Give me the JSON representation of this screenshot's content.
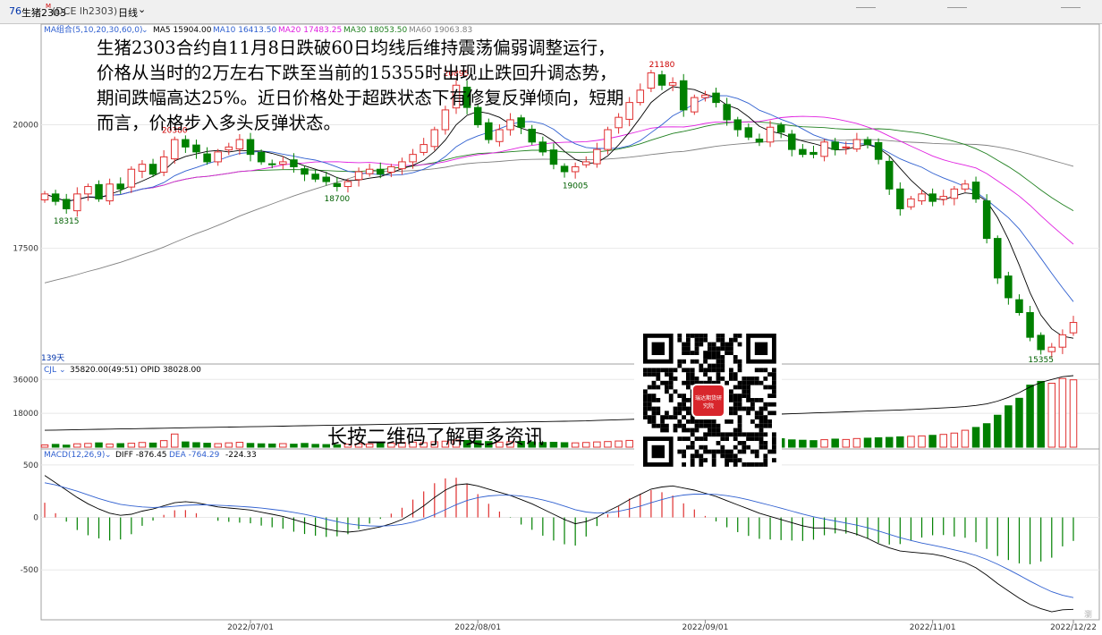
{
  "window": {
    "code_badge": "76",
    "instrument": "生猪2303",
    "superscript": "M",
    "exchange_code": "(DCE lh2303)",
    "period": "日线"
  },
  "indicators": {
    "ma_legend": "MA组合(5,10,20,30,60,0)",
    "ma5": "MA5 15904.00",
    "ma10": "MA10 16413.50",
    "ma20": "MA20 17483.25",
    "ma30": "MA30 18053.50",
    "ma60": "MA60 19063.83",
    "vol_legend": "CJL",
    "vol_text": "35820.00(49:51)",
    "opid_text": "OPID 38028.00",
    "macd_legend": "MACD(12,26,9)",
    "diff_text": "DIFF -876.45",
    "dea_text": "DEA -764.29",
    "macd_val": "-224.33",
    "bars_count": "139天"
  },
  "annotations": {
    "commentary": "生猪2303合约自11月8日跌破60日均线后维持震荡偏弱调整运行，价格从当时的2万左右下跌至当前的15355时出现止跌回升调态势，期间跌幅高达25%。近日价格处于超跌状态下有修复反弹倾向，短期而言，价格步入多头反弹状态。",
    "qr_caption": "长按二维码了解更多资讯",
    "qr_logo_text": "瑞达期货研究院",
    "watermark": "瀏"
  },
  "colors": {
    "up": "#e03030",
    "down": "#008000",
    "ma5": "#000000",
    "ma10": "#3060d0",
    "ma20": "#e020e0",
    "ma30": "#208020",
    "ma60": "#808080",
    "grid": "#e8e8e8"
  },
  "chart_data": {
    "type": "candlestick",
    "title": "生猪2303 (DCE lh2303) 日线",
    "x_dates": [
      "2022/07/01",
      "2022/08/01",
      "2022/09/01",
      "2022/11/01",
      "2022/12/22"
    ],
    "price_axis": {
      "ticks": [
        20000,
        17500
      ],
      "range": [
        15250,
        21800
      ]
    },
    "volume_axis": {
      "ticks": [
        36000,
        18000
      ],
      "range": [
        0,
        39000
      ]
    },
    "macd_axis": {
      "ticks": [
        500,
        0,
        -500
      ],
      "range": [
        -950,
        550
      ]
    },
    "labeled_prices": [
      {
        "label": "18315",
        "kind": "low"
      },
      {
        "label": "20380",
        "kind": "high"
      },
      {
        "label": "18700",
        "kind": "low"
      },
      {
        "label": "20895",
        "kind": "high"
      },
      {
        "label": "19005",
        "kind": "low"
      },
      {
        "label": "21180",
        "kind": "high"
      },
      {
        "label": "15355",
        "kind": "low"
      }
    ],
    "close_path": [
      18600,
      18450,
      18300,
      18600,
      18750,
      18500,
      18800,
      18700,
      19100,
      19200,
      19000,
      19350,
      19700,
      19550,
      19450,
      19250,
      19450,
      19550,
      19700,
      19400,
      19250,
      19200,
      19250,
      19150,
      19000,
      18900,
      18850,
      18750,
      18850,
      19050,
      19100,
      19000,
      19150,
      19250,
      19400,
      19600,
      19900,
      20300,
      20800,
      20350,
      20000,
      19700,
      19900,
      20100,
      19950,
      19650,
      19450,
      19200,
      19050,
      19150,
      19250,
      19500,
      19900,
      20150,
      20450,
      20700,
      21050,
      20800,
      20850,
      20300,
      20550,
      20600,
      20450,
      20100,
      19900,
      19750,
      19650,
      19950,
      19850,
      19500,
      19400,
      19400,
      19650,
      19500,
      19550,
      19700,
      19600,
      19300,
      18700,
      18300,
      18500,
      18600,
      18450,
      18550,
      18700,
      18800,
      18500,
      17700,
      16900,
      16500,
      16200,
      15700,
      15450,
      15500,
      15750,
      16000
    ],
    "volume": [
      1200,
      1500,
      1100,
      1800,
      2000,
      2300,
      1700,
      1900,
      2100,
      2500,
      2200,
      3500,
      7000,
      2800,
      2400,
      2100,
      1900,
      2300,
      2600,
      2000,
      1800,
      1700,
      1900,
      1600,
      2000,
      1500,
      1400,
      1300,
      1600,
      1800,
      1700,
      1900,
      2200,
      2500,
      2700,
      2400,
      2900,
      3200,
      3800,
      3600,
      3400,
      3000,
      2700,
      2900,
      3100,
      2800,
      2500,
      2600,
      2400,
      2300,
      2500,
      2800,
      3000,
      3300,
      3600,
      3400,
      3200,
      3500,
      3300,
      3100,
      3000,
      2900,
      3200,
      3400,
      3600,
      3800,
      4000,
      4200,
      4500,
      3900,
      3700,
      3500,
      4000,
      4300,
      4100,
      4600,
      4800,
      5000,
      5200,
      5500,
      5800,
      6000,
      6300,
      6800,
      7500,
      9000,
      10500,
      12500,
      17000,
      22000,
      26000,
      33000,
      35000,
      34000,
      36500,
      35820
    ],
    "opid": [
      9000,
      9100,
      9200,
      9300,
      9400,
      9500,
      9600,
      9700,
      9800,
      9900,
      10000,
      10100,
      10200,
      10300,
      10400,
      10500,
      10600,
      10700,
      10800,
      10900,
      11000,
      11100,
      11200,
      11300,
      11400,
      11500,
      11600,
      11700,
      11800,
      11900,
      12000,
      12100,
      12200,
      12300,
      12400,
      12500,
      12600,
      12700,
      12800,
      12900,
      13000,
      13100,
      13200,
      13300,
      13400,
      13500,
      13600,
      13700,
      13800,
      13900,
      14000,
      14200,
      14400,
      14600,
      14800,
      15000,
      15200,
      15400,
      15600,
      15800,
      16000,
      16200,
      16400,
      16600,
      16800,
      17000,
      17200,
      17400,
      17600,
      17800,
      18000,
      18200,
      18400,
      18600,
      18800,
      19000,
      19200,
      19400,
      19600,
      19800,
      20000,
      20300,
      20600,
      20900,
      21200,
      21600,
      22200,
      23000,
      24500,
      26500,
      29000,
      32000,
      34500,
      36000,
      37500,
      38028
    ],
    "diff": [
      400,
      330,
      260,
      190,
      130,
      80,
      40,
      20,
      30,
      60,
      80,
      110,
      140,
      150,
      140,
      120,
      100,
      90,
      80,
      70,
      50,
      30,
      10,
      -20,
      -50,
      -80,
      -110,
      -130,
      -140,
      -130,
      -110,
      -90,
      -60,
      -20,
      40,
      110,
      190,
      260,
      310,
      320,
      300,
      270,
      240,
      210,
      170,
      130,
      80,
      30,
      -20,
      -60,
      -40,
      0,
      60,
      110,
      170,
      220,
      270,
      290,
      300,
      280,
      260,
      230,
      200,
      160,
      120,
      80,
      40,
      10,
      -20,
      -50,
      -80,
      -100,
      -100,
      -110,
      -130,
      -160,
      -200,
      -250,
      -290,
      -320,
      -330,
      -340,
      -350,
      -370,
      -400,
      -430,
      -480,
      -550,
      -630,
      -700,
      -770,
      -830,
      -870,
      -900,
      -880,
      -876
    ],
    "dea": [
      330,
      310,
      280,
      250,
      215,
      180,
      150,
      125,
      110,
      100,
      95,
      98,
      106,
      115,
      120,
      120,
      116,
      111,
      105,
      98,
      89,
      77,
      64,
      48,
      29,
      7,
      -17,
      -40,
      -60,
      -74,
      -81,
      -83,
      -78,
      -66,
      -45,
      -14,
      27,
      74,
      121,
      161,
      189,
      205,
      212,
      212,
      204,
      189,
      167,
      140,
      108,
      74,
      51,
      41,
      45,
      58,
      80,
      108,
      140,
      170,
      196,
      213,
      222,
      223,
      219,
      207,
      190,
      168,
      142,
      115,
      88,
      60,
      32,
      6,
      -15,
      -34,
      -53,
      -74,
      -99,
      -129,
      -161,
      -193,
      -220,
      -244,
      -265,
      -286,
      -309,
      -333,
      -362,
      -400,
      -446,
      -497,
      -551,
      -607,
      -660,
      -708,
      -742,
      -764
    ]
  }
}
